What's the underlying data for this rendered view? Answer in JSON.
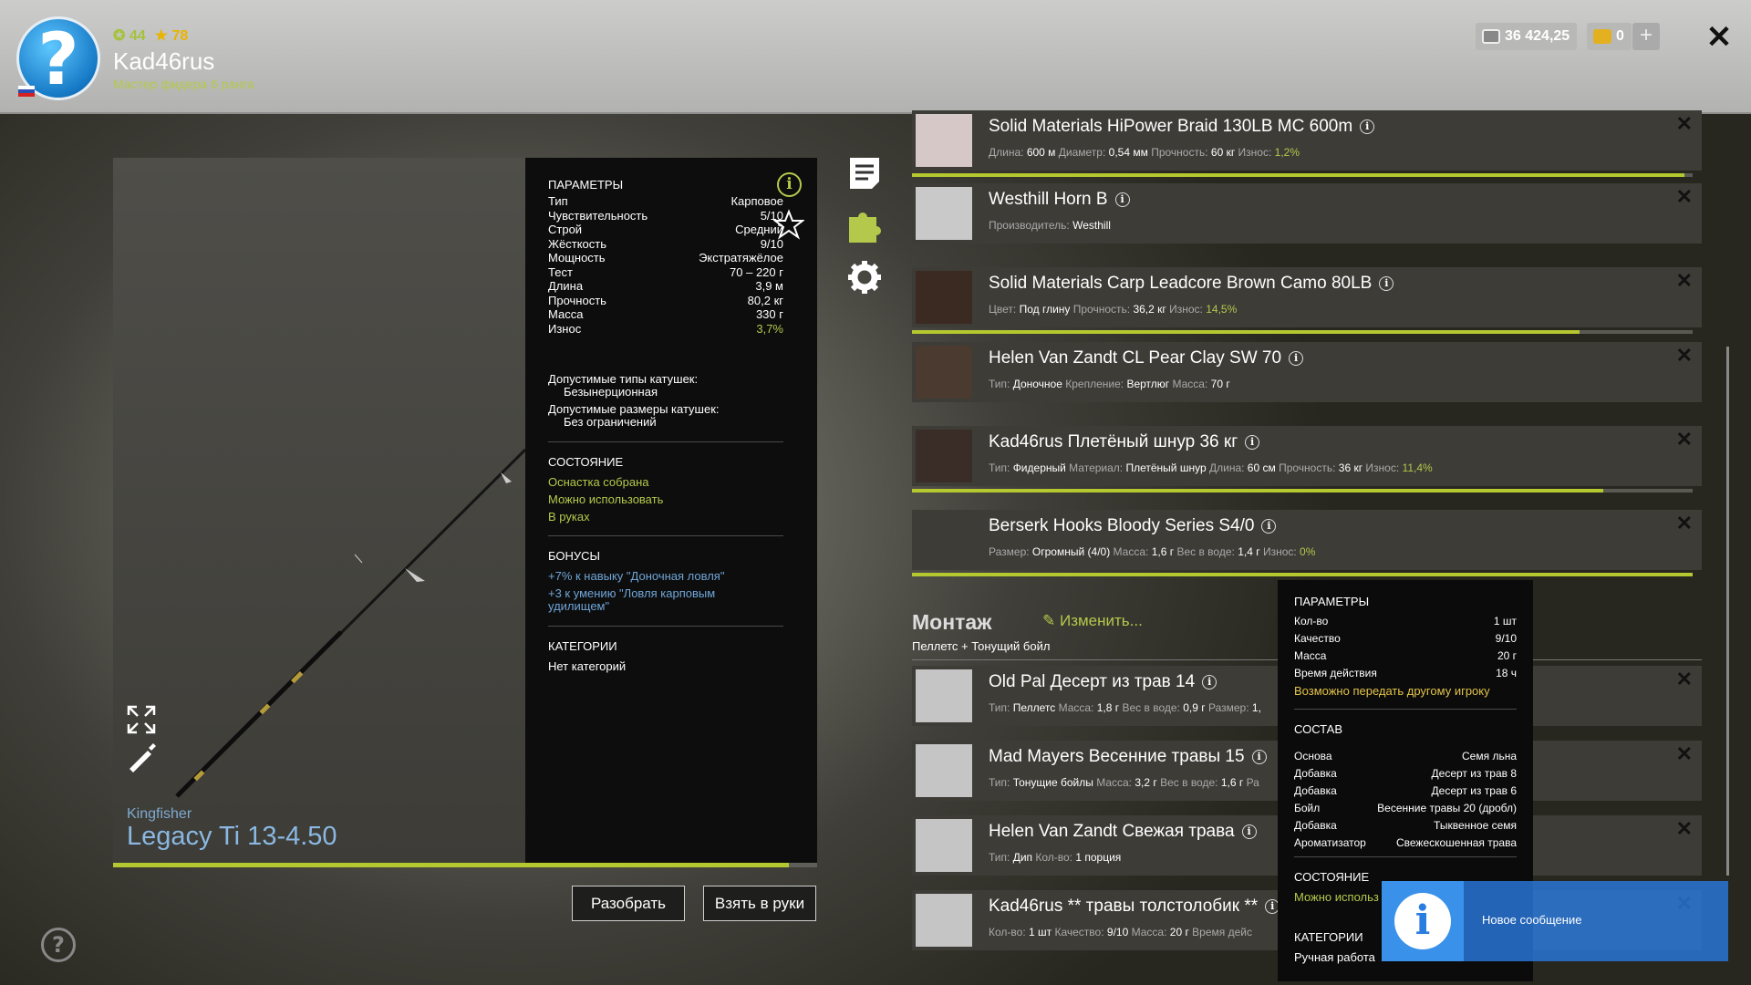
{
  "header": {
    "level": "44",
    "rating": "78",
    "username": "Kad46rus",
    "rank": "Мастер фидера 6 ранга",
    "silver": "36 424,25",
    "gold": "0",
    "plus": "+",
    "close": "✕"
  },
  "rod": {
    "brand": "Kingfisher",
    "name": "Legacy Ti 13-4.50",
    "wear_fraction": 0.96
  },
  "params": {
    "title": "ПАРАМЕТРЫ",
    "rows": [
      {
        "label": "Тип",
        "value": "Карповое"
      },
      {
        "label": "Чувствительность",
        "value": "5/10"
      },
      {
        "label": "Строй",
        "value": "Средний"
      },
      {
        "label": "Жёсткость",
        "value": "9/10"
      },
      {
        "label": "Мощность",
        "value": "Экстратяжёлое"
      },
      {
        "label": "Тест",
        "value": "70 – 220 г"
      },
      {
        "label": "Длина",
        "value": "3,9 м"
      },
      {
        "label": "Прочность",
        "value": "80,2 кг"
      },
      {
        "label": "Масса",
        "value": "330 г"
      },
      {
        "label": "Износ",
        "value": "3,7%"
      }
    ],
    "reel_types_label": "Допустимые типы катушек:",
    "reel_types_value": "Безынерционная",
    "reel_sizes_label": "Допустимые размеры катушек:",
    "reel_sizes_value": "Без ограничений",
    "state_title": "СОСТОЯНИЕ",
    "state": [
      "Оснастка собрана",
      "Можно использовать",
      "В руках"
    ],
    "bonus_title": "БОНУСЫ",
    "bonus1": "+7% к навыку \"Доночная ловля\"",
    "bonus2a": "+3 к умению \"Ловля карповым",
    "bonus2b": "удилищем\"",
    "cat_title": "КАТЕГОРИИ",
    "cat_value": "Нет категорий"
  },
  "buttons": {
    "disassemble": "Разобрать",
    "take": "Взять в руки"
  },
  "items": [
    {
      "name": "Solid Materials HiPower Braid 130LB MC 600m",
      "desc": [
        [
          "Длина:",
          "600 м"
        ],
        [
          "Диаметр:",
          "0,54 мм"
        ],
        [
          "Прочность:",
          "60 кг"
        ],
        [
          "Износ:",
          "1,2%"
        ]
      ],
      "wear": 0.99
    },
    {
      "name": "Westhill Horn B",
      "desc": [
        [
          "Производитель:",
          "Westhill"
        ]
      ]
    },
    {
      "name": "Solid Materials Carp Leadcore Brown Camo 80LB",
      "desc": [
        [
          "Цвет:",
          "Под глину"
        ],
        [
          "Прочность:",
          "36,2 кг"
        ],
        [
          "Износ:",
          "14,5%"
        ]
      ],
      "wear": 0.855
    },
    {
      "name": "Helen Van Zandt CL Pear Clay SW 70",
      "desc": [
        [
          "Тип:",
          "Доночное"
        ],
        [
          "Крепление:",
          "Вертлюг"
        ],
        [
          "Масса:",
          "70 г"
        ]
      ]
    },
    {
      "name": "Kad46rus Плетёный шнур 36 кг",
      "desc": [
        [
          "Тип:",
          "Фидерный"
        ],
        [
          "Материал:",
          "Плетёный шнур"
        ],
        [
          "Длина:",
          "60 см"
        ],
        [
          "Прочность:",
          "36 кг"
        ],
        [
          "Износ:",
          "11,4%"
        ]
      ],
      "wear": 0.886
    },
    {
      "name": "Berserk Hooks Bloody Series S4/0",
      "desc": [
        [
          "Размер:",
          "Огромный (4/0)"
        ],
        [
          "Масса:",
          "1,6 г"
        ],
        [
          "Вес в воде:",
          "1,4 г"
        ],
        [
          "Износ:",
          "0%"
        ]
      ],
      "wear": 1.0
    }
  ],
  "montage": {
    "title": "Монтаж",
    "edit": "Изменить...",
    "type": "Пеллетс  +  Тонущий бойл"
  },
  "baits": [
    {
      "name": "Old Pal Десерт из трав 14",
      "desc": [
        [
          "Тип:",
          "Пеллетс"
        ],
        [
          "Масса:",
          "1,8 г"
        ],
        [
          "Вес в воде:",
          "0,9 г"
        ],
        [
          "Размер:",
          "1,"
        ]
      ]
    },
    {
      "name": "Mad Mayers Весенние травы 15",
      "desc": [
        [
          "Тип:",
          "Тонущие бойлы"
        ],
        [
          "Масса:",
          "3,2 г"
        ],
        [
          "Вес в воде:",
          "1,6 г"
        ],
        [
          "Ра",
          ""
        ]
      ]
    },
    {
      "name": "Helen Van Zandt Свежая трава",
      "desc": [
        [
          "Тип:",
          "Дип"
        ],
        [
          "Кол-во:",
          "1 порция"
        ]
      ]
    },
    {
      "name": "Kad46rus ** травы толстолобик **",
      "desc": [
        [
          "Кол-во:",
          "1 шт"
        ],
        [
          "Качество:",
          "9/10"
        ],
        [
          "Масса:",
          "20 г"
        ],
        [
          "Время дейс",
          ""
        ]
      ]
    }
  ],
  "tooltip": {
    "title": "ПАРАМЕТРЫ",
    "rows": [
      [
        "Кол-во",
        "1 шт"
      ],
      [
        "Качество",
        "9/10"
      ],
      [
        "Масса",
        "20 г"
      ],
      [
        "Время действия",
        "18 ч"
      ]
    ],
    "transfer": "Возможно передать другому игроку",
    "comp_title": "СОСТАВ",
    "comp": [
      [
        "Основа",
        "Семя льна"
      ],
      [
        "Добавка",
        "Десерт из трав 8"
      ],
      [
        "Добавка",
        "Десерт из трав 6"
      ],
      [
        "Бойл",
        "Весенние травы 20 (дробл)"
      ],
      [
        "Добавка",
        "Тыквенное семя"
      ],
      [
        "Ароматизатор",
        "Свежескошенная трава"
      ]
    ],
    "state_title": "СОСТОЯНИЕ",
    "state": "Можно использ",
    "cat_title": "КАТЕГОРИИ",
    "cat": "Ручная работа"
  },
  "toast": {
    "text": "Новое сообщение"
  },
  "help": "?",
  "colors": {
    "accent": "#b4c94b",
    "link": "#6fa5d8",
    "bar": "#b6c830"
  }
}
